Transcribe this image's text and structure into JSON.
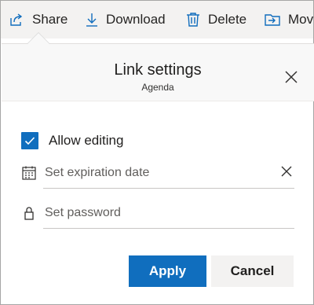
{
  "toolbar": {
    "share_label": "Share",
    "download_label": "Download",
    "delete_label": "Delete",
    "move_label": "Mov"
  },
  "dialog": {
    "title": "Link settings",
    "subtitle": "Agenda",
    "allow_editing": {
      "label": "Allow editing",
      "checked": true
    },
    "expiration": {
      "placeholder": "Set expiration date",
      "value": ""
    },
    "password": {
      "placeholder": "Set password",
      "value": ""
    },
    "apply_label": "Apply",
    "cancel_label": "Cancel"
  },
  "colors": {
    "accent": "#106ebe",
    "toolbar_bg": "#f3f2f1",
    "header_bg": "#f8f8f8"
  },
  "icons": [
    "share-icon",
    "download-icon",
    "delete-icon",
    "move-icon",
    "close-icon",
    "checkmark-icon",
    "calendar-icon",
    "lock-icon",
    "clear-icon"
  ]
}
